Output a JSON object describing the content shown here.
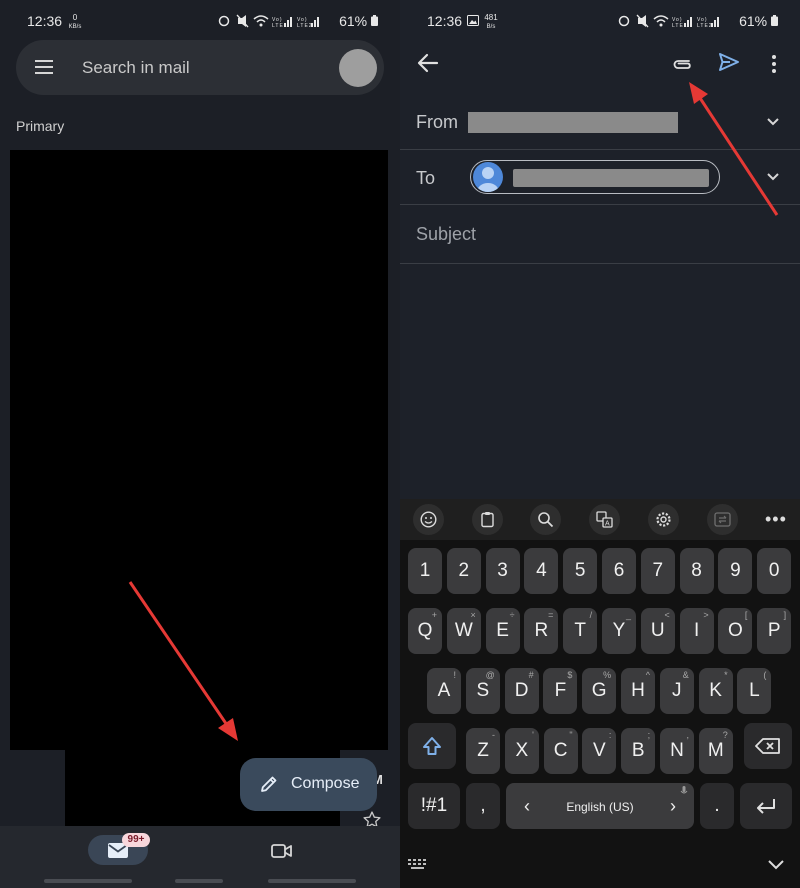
{
  "status_left": {
    "time": "12:36",
    "speed_value": "0",
    "speed_unit": "KB/s",
    "battery": "61%"
  },
  "status_right": {
    "time": "12:36",
    "speed_value": "481",
    "speed_unit": "B/s",
    "battery": "61%"
  },
  "inbox": {
    "search_placeholder": "Search in mail",
    "section_label": "Primary",
    "row_time_fragment": "M",
    "compose_label": "Compose",
    "mail_badge": "99+"
  },
  "compose_screen": {
    "from_label": "From",
    "to_label": "To",
    "subject_placeholder": "Subject"
  },
  "keyboard": {
    "number_row": [
      "1",
      "2",
      "3",
      "4",
      "5",
      "6",
      "7",
      "8",
      "9",
      "0"
    ],
    "row_q": [
      {
        "key": "Q",
        "hint": "+"
      },
      {
        "key": "W",
        "hint": "×"
      },
      {
        "key": "E",
        "hint": "÷"
      },
      {
        "key": "R",
        "hint": "="
      },
      {
        "key": "T",
        "hint": "/"
      },
      {
        "key": "Y",
        "hint": "_"
      },
      {
        "key": "U",
        "hint": "<"
      },
      {
        "key": "I",
        "hint": ">"
      },
      {
        "key": "O",
        "hint": "["
      },
      {
        "key": "P",
        "hint": "]"
      }
    ],
    "row_a": [
      {
        "key": "A",
        "hint": "!"
      },
      {
        "key": "S",
        "hint": "@"
      },
      {
        "key": "D",
        "hint": "#"
      },
      {
        "key": "F",
        "hint": "$"
      },
      {
        "key": "G",
        "hint": "%"
      },
      {
        "key": "H",
        "hint": "^"
      },
      {
        "key": "J",
        "hint": "&"
      },
      {
        "key": "K",
        "hint": "*"
      },
      {
        "key": "L",
        "hint": "("
      }
    ],
    "row_z": [
      {
        "key": "Z",
        "hint": "-"
      },
      {
        "key": "X",
        "hint": "'"
      },
      {
        "key": "C",
        "hint": "\""
      },
      {
        "key": "V",
        "hint": ":"
      },
      {
        "key": "B",
        "hint": ";"
      },
      {
        "key": "N",
        "hint": ","
      },
      {
        "key": "M",
        "hint": "?"
      }
    ],
    "symbols_key": "!#1",
    "comma_key": ",",
    "space_label": "English (US)",
    "space_left": "‹",
    "space_right": "›",
    "period_key": ".",
    "icons": {
      "emoji": "emoji-icon",
      "clipboard": "clipboard-icon",
      "search": "search-icon",
      "translate": "translate-icon",
      "settings": "gear-icon",
      "mode": "mode-switch-icon"
    }
  },
  "colors": {
    "arrow": "#e53935",
    "send": "#7fb0e8",
    "compose_bg": "#3a4a5c",
    "shift": "#7fb0e8"
  }
}
